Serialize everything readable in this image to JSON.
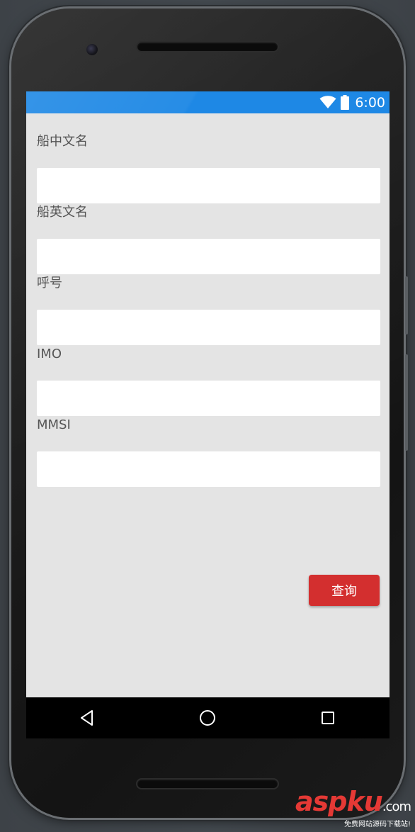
{
  "status_bar": {
    "time": "6:00",
    "color": "#1e88e5",
    "icons": [
      "wifi-icon",
      "battery-icon"
    ]
  },
  "form": {
    "fields": [
      {
        "label": "船中文名",
        "value": "",
        "placeholder": ""
      },
      {
        "label": "船英文名",
        "value": "",
        "placeholder": ""
      },
      {
        "label": "呼号",
        "value": "",
        "placeholder": ""
      },
      {
        "label": "IMO",
        "value": "",
        "placeholder": ""
      },
      {
        "label": "MMSI",
        "value": "",
        "placeholder": ""
      }
    ],
    "query_label": "查询",
    "query_color": "#d32f2f",
    "background": "#e4e4e4"
  },
  "nav_bar": {
    "icons": [
      "back-triangle-icon",
      "home-circle-icon",
      "recents-square-icon"
    ]
  },
  "watermark": {
    "logo_asp": "asp",
    "logo_ku": "ku",
    "logo_com": ".com",
    "tagline": "免费网站源码下载站!"
  }
}
